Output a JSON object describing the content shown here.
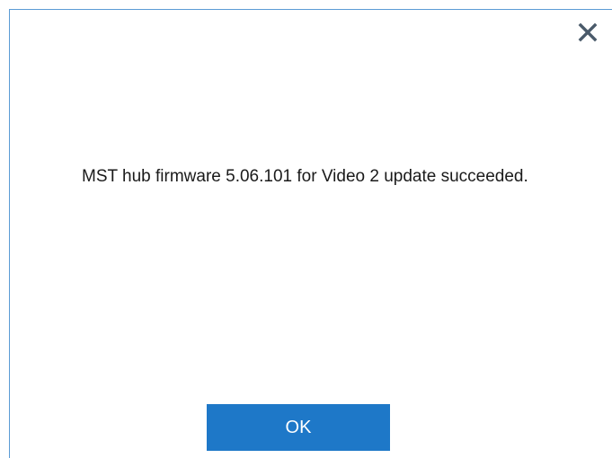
{
  "dialog": {
    "message": "MST hub firmware 5.06.101 for Video 2 update succeeded.",
    "ok_label": "OK",
    "close_icon": "close-icon"
  },
  "colors": {
    "accent": "#1e78c8",
    "border": "#5b9bd5",
    "icon": "#4a5a6a"
  }
}
